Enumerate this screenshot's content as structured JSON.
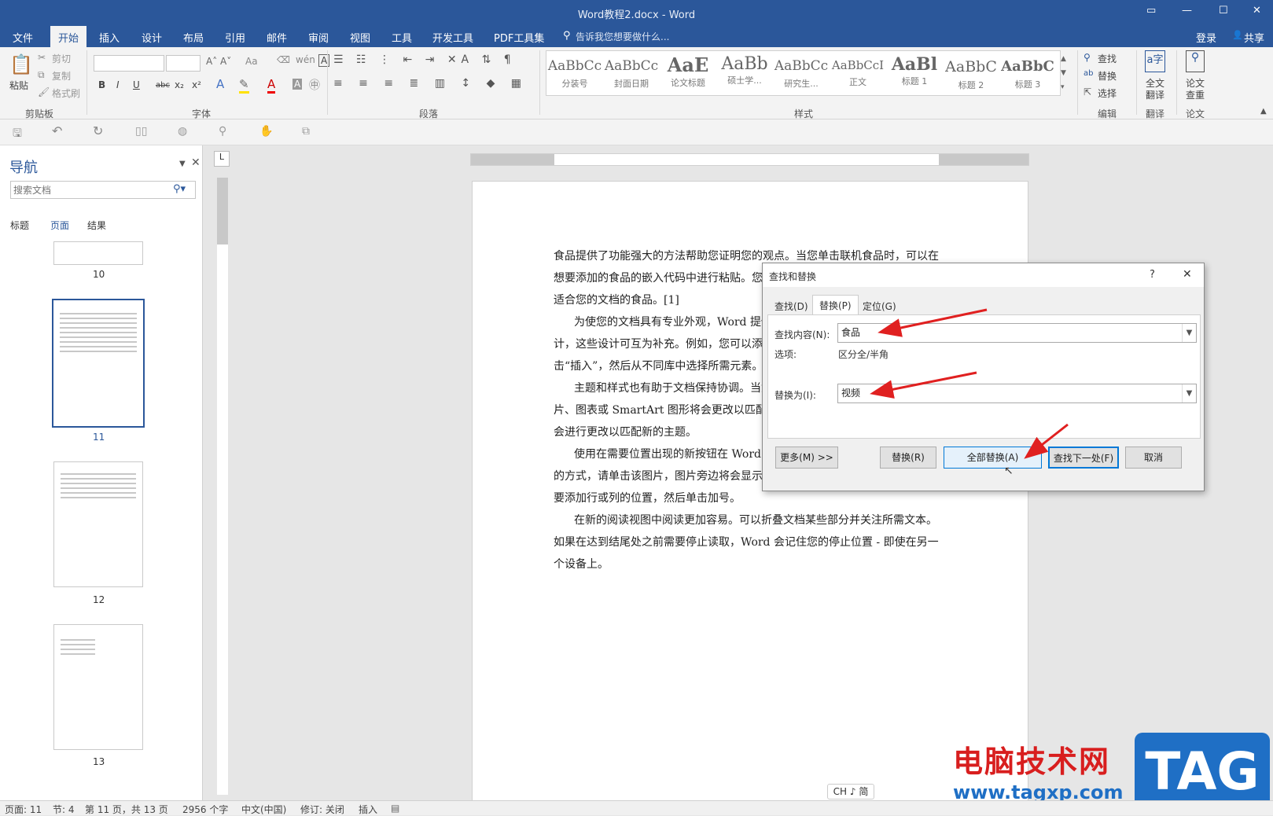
{
  "window": {
    "title": "Word教程2.docx - Word"
  },
  "menu": {
    "tabs": [
      "文件",
      "开始",
      "插入",
      "设计",
      "布局",
      "引用",
      "邮件",
      "审阅",
      "视图",
      "工具",
      "开发工具",
      "PDF工具集"
    ],
    "tell_me": "告诉我您想要做什么...",
    "login": "登录",
    "share": "共享"
  },
  "ribbon": {
    "clipboard": {
      "paste": "粘贴",
      "cut": "剪切",
      "copy": "复制",
      "format_painter": "格式刷",
      "label": "剪贴板"
    },
    "font": {
      "label": "字体",
      "bold": "B",
      "italic": "I",
      "underline": "U",
      "strike": "abc",
      "sub": "x₂",
      "sup": "x²"
    },
    "paragraph": {
      "label": "段落"
    },
    "styles": {
      "label": "样式",
      "items": [
        {
          "sample": "AaBbCc",
          "name": "分装号"
        },
        {
          "sample": "AaBbCc",
          "name": "封面日期"
        },
        {
          "sample": "AaE",
          "name": "论文标题"
        },
        {
          "sample": "AaBb",
          "name": "硕士学..."
        },
        {
          "sample": "AaBbCc",
          "name": "研究生..."
        },
        {
          "sample": "AaBbCcI",
          "name": "正文"
        },
        {
          "sample": "AaBl",
          "name": "标题 1"
        },
        {
          "sample": "AaBbC",
          "name": "标题 2"
        },
        {
          "sample": "AaBbC",
          "name": "标题 3"
        }
      ]
    },
    "editing": {
      "find": "查找",
      "replace": "替换",
      "select": "选择",
      "label": "编辑"
    },
    "translate": {
      "full": "全文",
      "full2": "翻译",
      "label": "翻译"
    },
    "paper": {
      "check": "论文",
      "check2": "查重",
      "label": "论文"
    }
  },
  "nav": {
    "title": "导航",
    "search_placeholder": "搜索文档",
    "tabs": [
      "标题",
      "页面",
      "结果"
    ],
    "pages": [
      "10",
      "11",
      "12",
      "13"
    ]
  },
  "document": {
    "paragraphs": [
      "食品提供了功能强大的方法帮助您证明您的观点。当您单击联机食品时，可以在想要添加的食品的嵌入代码中进行粘贴。您也可以键入一个关键字以联机搜索最适合您的文档的食品。[1]",
      "为使您的文档具有专业外观，Word 提供了页眉、页脚、封面和文本框设计，这些设计可互为补充。例如，您可以添加匹配的封面、页眉和提要栏。单击“插入”，然后从不同库中选择所需元素。",
      "主题和样式也有助于文档保持协调。当您单击设计并选择新的主题时，图片、图表或 SmartArt 图形将会更改以匹配新的主题。当应用样式时，您的标题会进行更改以匹配新的主题。",
      "使用在需要位置出现的新按钮在 Word 中节省时间。若要更改图片适应文档的方式，请单击该图片，图片旁边将会显示布局选项按钮。当处理表格时，单击要添加行或列的位置，然后单击加号。",
      "在新的阅读视图中阅读更加容易。可以折叠文档某些部分并关注所需文本。如果在达到结尾处之前需要停止读取，Word 会记住您的停止位置 - 即使在另一个设备上。"
    ]
  },
  "dialog": {
    "title": "查找和替换",
    "help": "?",
    "close": "✕",
    "tabs": [
      "查找(D)",
      "替换(P)",
      "定位(G)"
    ],
    "find_label": "查找内容(N):",
    "find_value": "食品",
    "options_label": "选项:",
    "options_value": "区分全/半角",
    "replace_label": "替换为(I):",
    "replace_value": "视频",
    "buttons": {
      "more": "更多(M) >>",
      "replace": "替换(R)",
      "replace_all": "全部替换(A)",
      "find_next": "查找下一处(F)",
      "cancel": "取消"
    }
  },
  "ime": "CH ♪ 简",
  "status": {
    "page": "页面: 11",
    "section": "节: 4",
    "pages": "第 11 页，共 13 页",
    "words": "2956 个字",
    "lang": "中文(中国)",
    "track": "修订: 关闭",
    "insert": "插入"
  },
  "watermark": {
    "text": "电脑技术网",
    "url": "www.tagxp.com",
    "logo": "TAG"
  },
  "colors": {
    "brand": "#2b579a",
    "arrow": "#e02020",
    "watermark_red": "#d81e1e",
    "watermark_blue": "#1f6fc5"
  }
}
